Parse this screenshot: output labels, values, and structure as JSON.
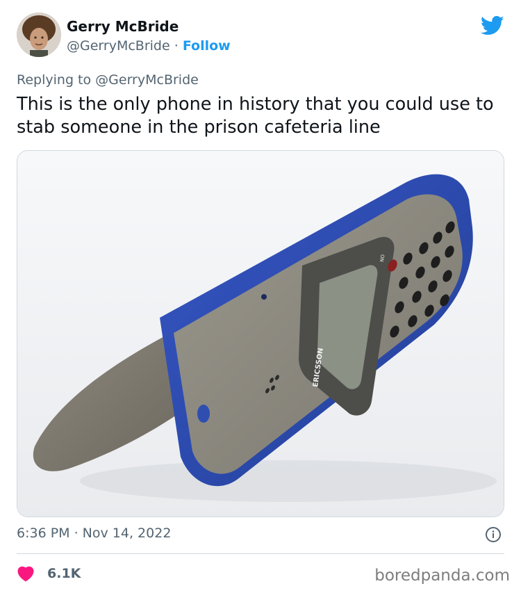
{
  "author": {
    "name": "Gerry McBride",
    "handle": "@GerryMcBride",
    "separator": "·",
    "follow_label": "Follow"
  },
  "reply": {
    "prefix": "Replying to",
    "handle": "@GerryMcBride"
  },
  "tweet": {
    "text": "This is the only phone in history that you could use to stab someone in the prison cafeteria line"
  },
  "media": {
    "brand_text": "ERICSSON",
    "key_label": "NO"
  },
  "meta": {
    "timestamp": "6:36 PM · Nov 14, 2022"
  },
  "engagement": {
    "like_count": "6.1K"
  },
  "watermark": "boredpanda.com",
  "colors": {
    "accent": "#1d9bf0",
    "like": "#f91880",
    "secondary_text": "#536471",
    "phone_blue": "#2f4fb0",
    "phone_gray": "#8c8a80"
  },
  "icons": {
    "brand": "twitter-bird-icon",
    "info": "info-icon",
    "like": "heart-icon"
  }
}
